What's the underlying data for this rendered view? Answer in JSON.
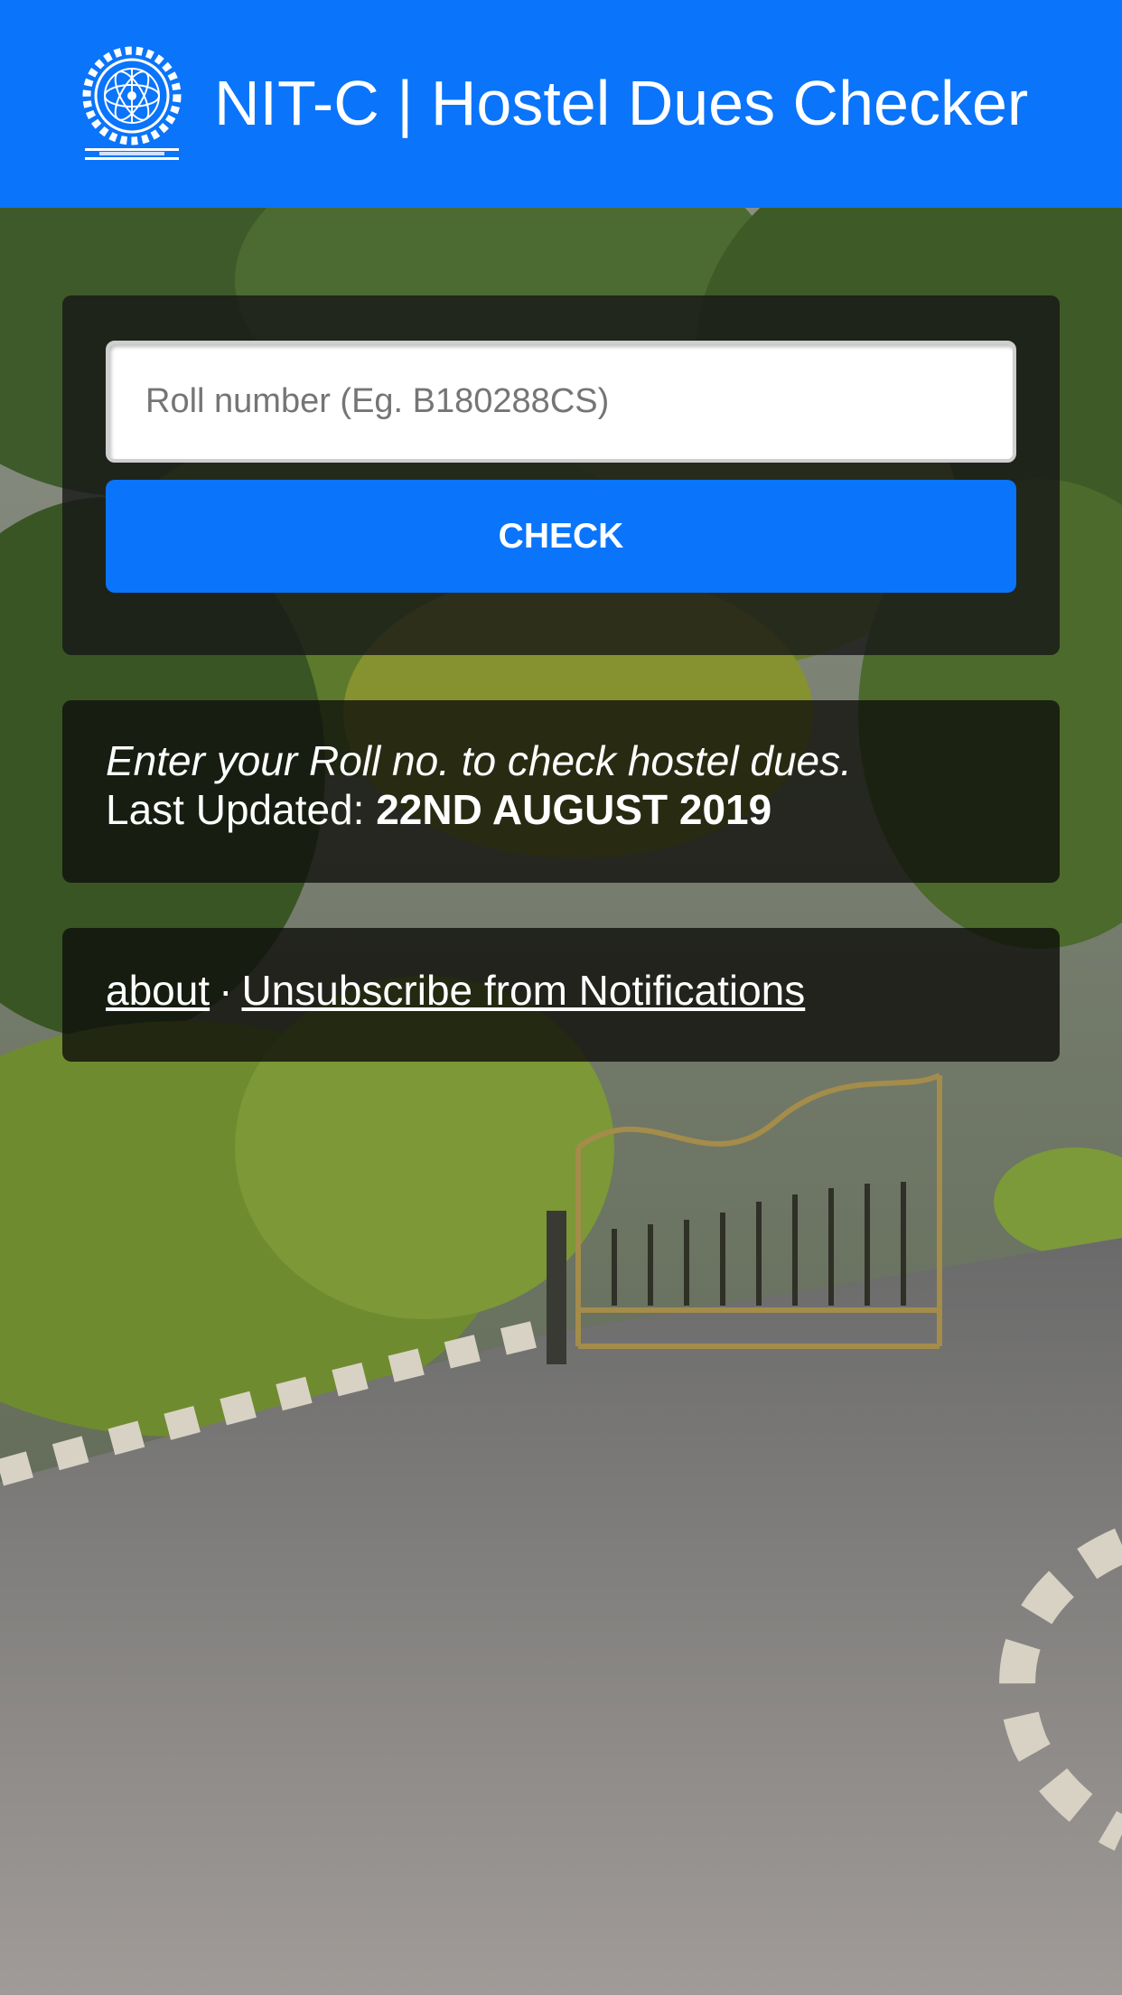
{
  "header": {
    "title": "NIT-C | Hostel Dues Checker",
    "logo_text": "NATIONAL INSTITUTE OF TECHNOLOGY CALICUT"
  },
  "search": {
    "placeholder": "Roll number (Eg. B180288CS)",
    "value": "",
    "button_label": "CHECK"
  },
  "info": {
    "prompt": "Enter your Roll no. to check hostel dues.",
    "updated_label": "Last Updated:",
    "updated_value": "22ND AUGUST 2019"
  },
  "links": {
    "about": "about",
    "separator": "·",
    "unsubscribe": "Unsubscribe from Notifications"
  },
  "colors": {
    "header_bg": "#0a74fb",
    "button_bg": "#0a74fb",
    "card_bg": "#161616",
    "text": "#ffffff"
  },
  "icons": {
    "logo": "nitc-emblem-icon"
  }
}
